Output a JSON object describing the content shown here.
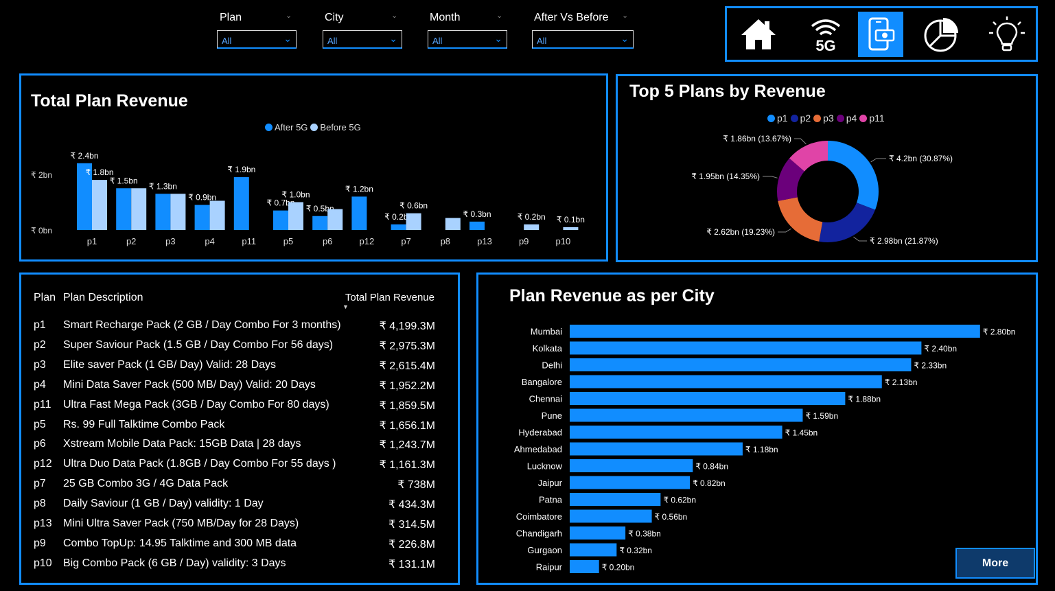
{
  "filters": [
    {
      "label": "Plan",
      "value": "All"
    },
    {
      "label": "City",
      "value": "All"
    },
    {
      "label": "Month",
      "value": "All"
    },
    {
      "label": "After Vs Before",
      "value": "All"
    }
  ],
  "nav": [
    {
      "icon": "home-icon",
      "active": false
    },
    {
      "icon": "5g-icon",
      "label": "5G",
      "active": true
    },
    {
      "icon": "mobile-payment-icon",
      "active": true
    },
    {
      "icon": "pie-chart-icon",
      "active": false
    },
    {
      "icon": "lightbulb-icon",
      "active": false
    }
  ],
  "colors": {
    "accent": "#118DFF",
    "after": "#118DFF",
    "before": "#A9D2FF",
    "panel_border": "#118DFF",
    "more_bg": "#0E3A6B"
  },
  "total_revenue": {
    "title": "Total Plan Revenue",
    "legend": [
      {
        "name": "After 5G",
        "color": "#118DFF"
      },
      {
        "name": "Before 5G",
        "color": "#A9D2FF"
      }
    ],
    "y_ticks": [
      "₹ 0bn",
      "₹ 2bn"
    ]
  },
  "top5": {
    "title": "Top 5 Plans by Revenue",
    "legend": [
      {
        "name": "p1",
        "color": "#118DFF"
      },
      {
        "name": "p2",
        "color": "#12239E"
      },
      {
        "name": "p3",
        "color": "#E66C37"
      },
      {
        "name": "p4",
        "color": "#6B007B"
      },
      {
        "name": "p11",
        "color": "#E044A7"
      }
    ]
  },
  "table": {
    "headers": {
      "plan": "Plan",
      "desc": "Plan Description",
      "revenue": "Total Plan Revenue"
    },
    "rows": [
      {
        "plan": "p1",
        "desc": "Smart Recharge Pack (2 GB / Day Combo For 3 months)",
        "revenue": "₹ 4,199.3M"
      },
      {
        "plan": "p2",
        "desc": "Super Saviour Pack (1.5 GB / Day Combo For 56 days)",
        "revenue": "₹ 2,975.3M"
      },
      {
        "plan": "p3",
        "desc": "Elite saver Pack (1 GB/ Day) Valid: 28 Days",
        "revenue": "₹ 2,615.4M"
      },
      {
        "plan": "p4",
        "desc": "Mini Data Saver Pack (500 MB/ Day) Valid: 20 Days",
        "revenue": "₹ 1,952.2M"
      },
      {
        "plan": "p11",
        "desc": "Ultra Fast Mega Pack (3GB / Day Combo For 80 days)",
        "revenue": "₹ 1,859.5M"
      },
      {
        "plan": "p5",
        "desc": "Rs. 99 Full Talktime Combo Pack",
        "revenue": "₹ 1,656.1M"
      },
      {
        "plan": "p6",
        "desc": "Xstream Mobile Data Pack: 15GB Data | 28 days",
        "revenue": "₹ 1,243.7M"
      },
      {
        "plan": "p12",
        "desc": "Ultra Duo Data Pack (1.8GB / Day Combo For 55 days )",
        "revenue": "₹ 1,161.3M"
      },
      {
        "plan": "p7",
        "desc": "25 GB Combo 3G / 4G Data Pack",
        "revenue": "₹ 738M"
      },
      {
        "plan": "p8",
        "desc": "Daily Saviour (1 GB / Day) validity: 1 Day",
        "revenue": "₹ 434.3M"
      },
      {
        "plan": "p13",
        "desc": "Mini Ultra Saver Pack (750 MB/Day for 28 Days)",
        "revenue": "₹ 314.5M"
      },
      {
        "plan": "p9",
        "desc": "Combo TopUp: 14.95 Talktime and 300 MB data",
        "revenue": "₹ 226.8M"
      },
      {
        "plan": "p10",
        "desc": "Big Combo Pack (6 GB / Day) validity: 3 Days",
        "revenue": "₹ 131.1M"
      }
    ]
  },
  "city_panel": {
    "title": "Plan Revenue as per City"
  },
  "more_button": "More",
  "chart_data": [
    {
      "type": "bar",
      "title": "Total Plan Revenue",
      "categories": [
        "p1",
        "p2",
        "p3",
        "p4",
        "p11",
        "p5",
        "p6",
        "p12",
        "p7",
        "p8",
        "p13",
        "p9",
        "p10"
      ],
      "series": [
        {
          "name": "After 5G",
          "values": [
            2.4,
            1.5,
            1.3,
            0.9,
            1.9,
            0.7,
            0.5,
            1.2,
            0.2,
            null,
            0.3,
            null,
            null
          ],
          "labels": [
            "₹ 2.4bn",
            "₹ 1.5bn",
            "₹ 1.3bn",
            "₹ 0.9bn",
            "₹ 1.9bn",
            "₹ 0.7bn",
            "₹ 0.5bn",
            "₹ 1.2bn",
            "₹ 0.2bn",
            null,
            "₹ 0.3bn",
            null,
            null
          ]
        },
        {
          "name": "Before 5G",
          "values": [
            1.8,
            1.5,
            1.3,
            1.05,
            null,
            1.0,
            0.75,
            null,
            0.6,
            0.43,
            null,
            0.2,
            0.1
          ],
          "labels": [
            "₹ 1.8bn",
            null,
            null,
            null,
            null,
            "₹ 1.0bn",
            null,
            null,
            "₹ 0.6bn",
            null,
            null,
            "₹ 0.2bn",
            "₹ 0.1bn"
          ]
        }
      ],
      "ylim": [
        0,
        2.4
      ],
      "y_ticks": [
        "₹ 0bn",
        "₹ 2bn"
      ],
      "legend": "top-center"
    },
    {
      "type": "pie",
      "title": "Top 5 Plans by Revenue",
      "donut": true,
      "categories": [
        "p1",
        "p2",
        "p3",
        "p4",
        "p11"
      ],
      "values": [
        4.2,
        2.98,
        2.62,
        1.95,
        1.86
      ],
      "labels": [
        "₹ 4.2bn (30.87%)",
        "₹ 2.98bn (21.87%)",
        "₹ 2.62bn (19.23%)",
        "₹ 1.95bn (14.35%)",
        "₹ 1.86bn (13.67%)"
      ],
      "legend": "top-center"
    },
    {
      "type": "bar",
      "orientation": "horizontal",
      "title": "Plan Revenue as per City",
      "categories": [
        "Mumbai",
        "Kolkata",
        "Delhi",
        "Bangalore",
        "Chennai",
        "Pune",
        "Hyderabad",
        "Ahmedabad",
        "Lucknow",
        "Jaipur",
        "Patna",
        "Coimbatore",
        "Chandigarh",
        "Gurgaon",
        "Raipur"
      ],
      "values": [
        2.8,
        2.4,
        2.33,
        2.13,
        1.88,
        1.59,
        1.45,
        1.18,
        0.84,
        0.82,
        0.62,
        0.56,
        0.38,
        0.32,
        0.2
      ],
      "labels": [
        "₹ 2.80bn",
        "₹ 2.40bn",
        "₹ 2.33bn",
        "₹ 2.13bn",
        "₹ 1.88bn",
        "₹ 1.59bn",
        "₹ 1.45bn",
        "₹ 1.18bn",
        "₹ 0.84bn",
        "₹ 0.82bn",
        "₹ 0.62bn",
        "₹ 0.56bn",
        "₹ 0.38bn",
        "₹ 0.32bn",
        "₹ 0.20bn"
      ]
    }
  ]
}
